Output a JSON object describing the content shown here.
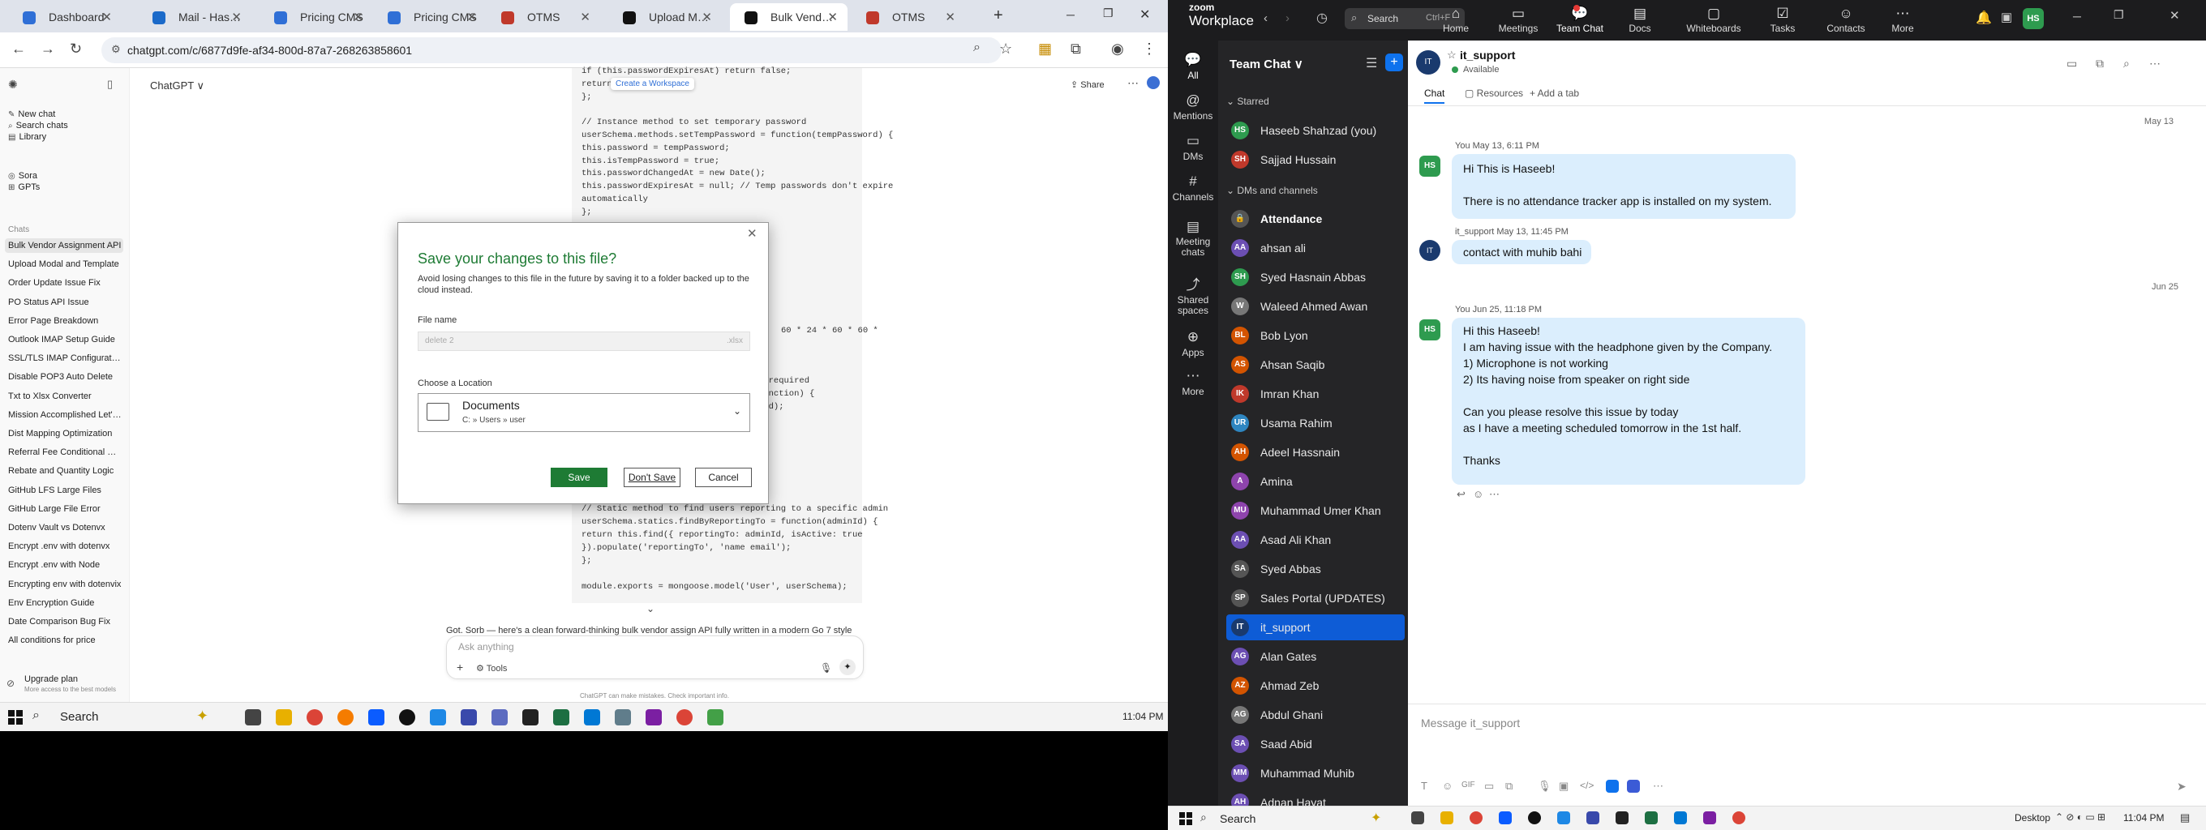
{
  "colors": {
    "tab_bg": "#dfe3eb",
    "zoom_dark": "#1c1c1e",
    "zoom_list": "#252527",
    "zoom_blue": "#0e5cd6",
    "bubble": "#dbeefd",
    "save_green": "#1e7b34",
    "dialog_title": "#1e7b34"
  },
  "browser": {
    "tabs": [
      {
        "title": "Dashboard",
        "color": "#2f6fd6"
      },
      {
        "title": "Mail - Haseeb",
        "color": "#1b6ac9"
      },
      {
        "title": "Pricing CMS",
        "color": "#2f6fd6"
      },
      {
        "title": "Pricing CMS",
        "color": "#2f6fd6"
      },
      {
        "title": "OTMS",
        "color": "#c0392b"
      },
      {
        "title": "Upload Moda",
        "color": "#111"
      },
      {
        "title": "Bulk Vendor A",
        "color": "#111"
      },
      {
        "title": "OTMS",
        "color": "#c0392b"
      }
    ],
    "new_tab": "+",
    "url": "chatgpt.com/c/6877d9fe-af34-800d-87a7-268263858601"
  },
  "chatgpt": {
    "model": "ChatGPT ∨",
    "share": "Share",
    "menu": [
      {
        "label": "New chat",
        "icon": "edit-icon"
      },
      {
        "label": "Search chats",
        "icon": "search-icon"
      },
      {
        "label": "Library",
        "icon": "library-icon"
      },
      {
        "label": "Sora",
        "icon": "sora-icon"
      },
      {
        "label": "GPTs",
        "icon": "gpts-icon"
      }
    ],
    "chats_heading": "Chats",
    "chats": [
      "Bulk Vendor Assignment API",
      "Upload Modal and Template",
      "Order Update Issue Fix",
      "PO Status API Issue",
      "Error Page Breakdown",
      "Outlook IMAP Setup Guide",
      "SSL/TLS IMAP Configuration",
      "Disable POP3 Auto Delete",
      "Txt to Xlsx Converter",
      "Mission Accomplished Let's Vi...",
      "Dist Mapping Optimization",
      "Referral Fee Conditional Display",
      "Rebate and Quantity Logic",
      "GitHub LFS Large Files",
      "GitHub Large File Error",
      "Dotenv Vault vs Dotenvx",
      "Encrypt .env with dotenvx",
      "Encrypt .env with Node",
      "Encrypting env with dotenvix",
      "Env Encryption Guide",
      "Date Comparison Bug Fix",
      "All conditions for price"
    ],
    "upgrade_title": "Upgrade plan",
    "upgrade_sub": "More access to the best models",
    "code_lines": [
      "if (this.passwordExpiresAt) return false;",
      "return          < new Date();",
      "};",
      "",
      "// Instance method to set temporary password",
      "userSchema.methods.setTempPassword = function(tempPassword) {",
      "  this.password = tempPassword;",
      "  this.isTempPassword = true;",
      "  this.passwordChangedAt = new Date();",
      "  this.passwordExpiresAt = null; // Temp passwords don't expire",
      "automatically",
      "};"
    ],
    "code_right_lines": [
      "s)",
      "60 * 24 * 60 * 60 *",
      "s required",
      "function) {",
      "red);"
    ],
    "code_bottom_lines": [
      "// Static method to find users reporting to a specific admin",
      "userSchema.statics.findByReportingTo = function(adminId) {",
      "  return this.find({ reportingTo: adminId, isActive: true",
      "}).populate('reportingTo', 'name email');",
      "};",
      "",
      "module.exports = mongoose.model('User', userSchema);"
    ],
    "workspace_chip": "Create a Workspace",
    "response_text": "Got. Sorb — here's a clean forward-thinking bulk vendor assign API fully written in a modern Go 7 style",
    "ask_placeholder": "Ask anything",
    "tools": "Tools",
    "disclaimer": "ChatGPT can make mistakes. Check important info."
  },
  "dialog": {
    "title": "Save your changes to this file?",
    "subtitle": "Avoid losing changes to this file in the future by saving it to a folder backed up to the cloud instead.",
    "file_name_label": "File name",
    "file_name_value": "delete 2",
    "file_ext": ".xlsx",
    "location_label": "Choose a Location",
    "location_name": "Documents",
    "location_path": "C: » Users » user",
    "save": "Save",
    "dont_save": "Don't Save",
    "cancel": "Cancel"
  },
  "taskbar_left": {
    "search": "Search",
    "time": "11:04 PM"
  },
  "zoom": {
    "brand_top": "zoom",
    "brand": "Workplace",
    "search": "Search",
    "search_shortcut": "Ctrl+F",
    "nav": [
      {
        "label": "Home",
        "icon": "home-icon"
      },
      {
        "label": "Meetings",
        "icon": "video-icon"
      },
      {
        "label": "Team Chat",
        "icon": "chat-icon"
      },
      {
        "label": "Docs",
        "icon": "docs-icon"
      },
      {
        "label": "Whiteboards",
        "icon": "whiteboard-icon"
      },
      {
        "label": "Tasks",
        "icon": "tasks-icon"
      },
      {
        "label": "Contacts",
        "icon": "contacts-icon"
      },
      {
        "label": "More",
        "icon": "more-icon"
      }
    ],
    "avatar": "HS",
    "rail": [
      {
        "label": "All"
      },
      {
        "label": "Mentions"
      },
      {
        "label": "DMs"
      },
      {
        "label": "Channels"
      },
      {
        "label": "Meeting chats"
      },
      {
        "label": "Shared spaces"
      },
      {
        "label": "Apps"
      },
      {
        "label": "More"
      }
    ],
    "panel_title": "Team Chat ∨",
    "starred_label": "Starred",
    "dms_label": "DMs and channels",
    "starred": [
      {
        "name": "Haseeb Shahzad (you)",
        "initials": "HS",
        "color": "#2e9b4f"
      },
      {
        "name": "Sajjad Hussain",
        "initials": "SH",
        "color": "#c0392b"
      }
    ],
    "contacts": [
      {
        "name": "Attendance",
        "initials": "🔒",
        "color": "#555"
      },
      {
        "name": "ahsan ali",
        "initials": "AA",
        "color": "#6c4fb3"
      },
      {
        "name": "Syed Hasnain Abbas",
        "initials": "SH",
        "color": "#2e9b4f"
      },
      {
        "name": "Waleed Ahmed Awan",
        "initials": "W",
        "color": "#777"
      },
      {
        "name": "Bob Lyon",
        "initials": "BL",
        "color": "#d35400"
      },
      {
        "name": "Ahsan Saqib",
        "initials": "AS",
        "color": "#d35400"
      },
      {
        "name": "Imran Khan",
        "initials": "IK",
        "color": "#c0392b"
      },
      {
        "name": "Usama Rahim",
        "initials": "UR",
        "color": "#2e86c1"
      },
      {
        "name": "Adeel Hassnain",
        "initials": "AH",
        "color": "#d35400"
      },
      {
        "name": "Amina",
        "initials": "A",
        "color": "#8e44ad"
      },
      {
        "name": "Muhammad Umer Khan",
        "initials": "MU",
        "color": "#8e44ad"
      },
      {
        "name": "Asad Ali Khan",
        "initials": "AA",
        "color": "#6c4fb3"
      },
      {
        "name": "Syed Abbas",
        "initials": "SA",
        "color": "#555"
      },
      {
        "name": "Sales Portal (UPDATES)",
        "initials": "SP",
        "color": "#555"
      },
      {
        "name": "it_support",
        "initials": "IT",
        "color": "#1a3a6e"
      },
      {
        "name": "Alan Gates",
        "initials": "AG",
        "color": "#6c4fb3"
      },
      {
        "name": "Ahmad Zeb",
        "initials": "AZ",
        "color": "#d35400"
      },
      {
        "name": "Abdul Ghani",
        "initials": "AG",
        "color": "#777"
      },
      {
        "name": "Saad Abid",
        "initials": "SA",
        "color": "#6c4fb3"
      },
      {
        "name": "Muhammad Muhib",
        "initials": "MM",
        "color": "#6c4fb3"
      },
      {
        "name": "Adnan Hayat",
        "initials": "AH",
        "color": "#6c4fb3"
      }
    ],
    "chat": {
      "name": "it_support",
      "status": "Available",
      "tabs": [
        "Chat",
        "Resources",
        "+ Add a tab"
      ],
      "date1": "May 13",
      "msg1_meta": "You May 13, 6:11 PM",
      "msg1_lines": [
        "Hi This is Haseeb!",
        "",
        "There is no attendance tracker app is installed on my system."
      ],
      "msg2_meta": "it_support May 13, 11:45 PM",
      "msg2_text": "contact with muhib bahi",
      "date2": "Jun 25",
      "msg3_meta": "You Jun 25, 11:18 PM",
      "msg3_lines": [
        "Hi this Haseeb!",
        "I am having issue with the headphone given by the Company.",
        "1) Microphone is not working",
        "2) Its having noise from speaker on right side",
        "",
        "Can you please resolve this issue by today",
        "as I have a meeting scheduled tomorrow in the 1st half.",
        "",
        "Thanks"
      ],
      "composer_placeholder": "Message it_support"
    }
  },
  "taskbar_right": {
    "search": "Search",
    "desktop": "Desktop",
    "time": "11:04 PM"
  }
}
